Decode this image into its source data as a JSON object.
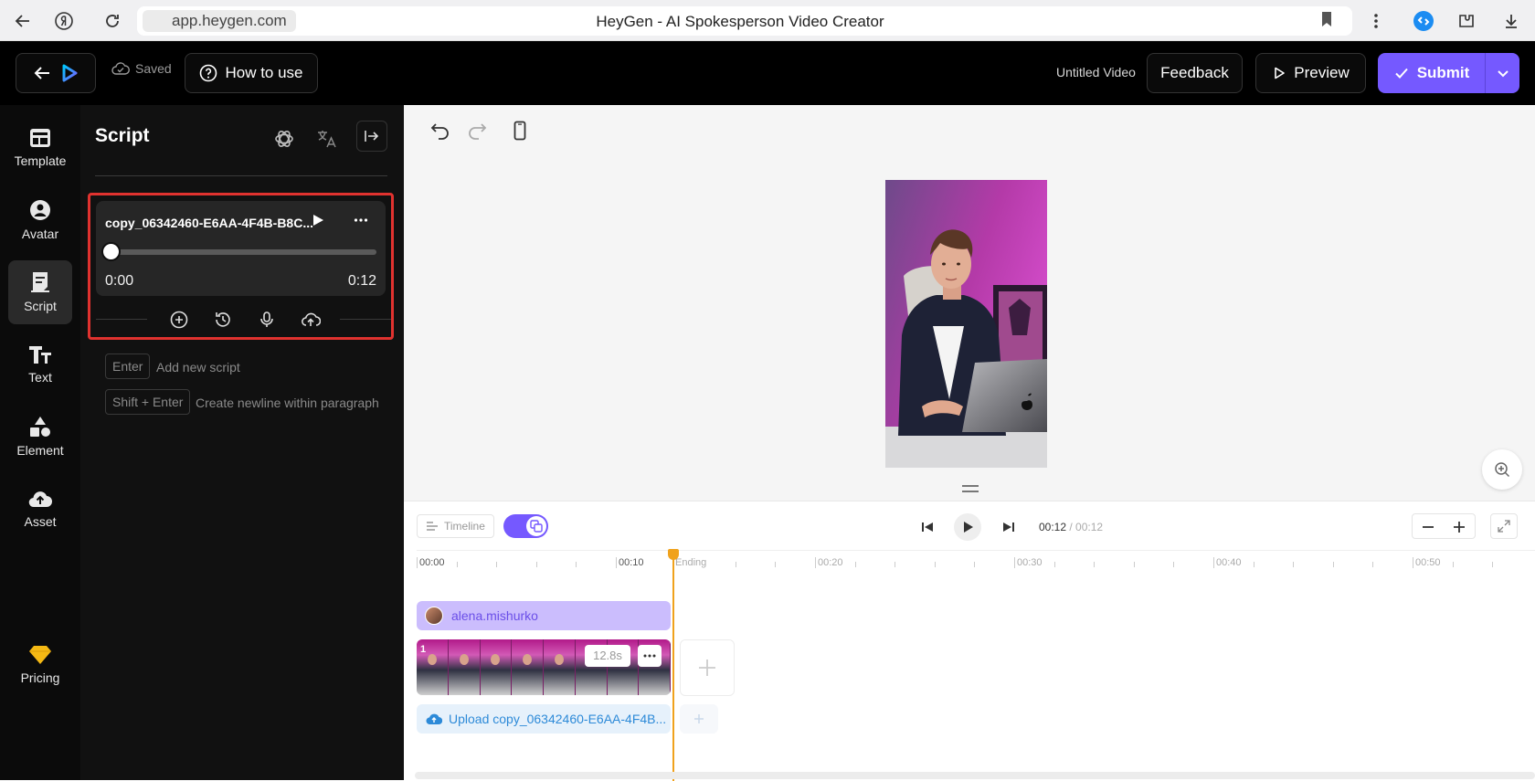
{
  "browser": {
    "url": "app.heygen.com",
    "title": "HeyGen - AI Spokesperson Video Creator"
  },
  "header": {
    "saved_label": "Saved",
    "how_to_use_label": "How to use",
    "video_title": "Untitled Video",
    "feedback_label": "Feedback",
    "preview_label": "Preview",
    "submit_label": "Submit"
  },
  "sidebar": {
    "items": [
      {
        "label": "Template",
        "icon": "template-icon"
      },
      {
        "label": "Avatar",
        "icon": "avatar-icon"
      },
      {
        "label": "Script",
        "icon": "script-icon",
        "active": true
      },
      {
        "label": "Text",
        "icon": "text-icon"
      },
      {
        "label": "Element",
        "icon": "element-icon"
      },
      {
        "label": "Asset",
        "icon": "asset-icon"
      }
    ],
    "pricing_label": "Pricing"
  },
  "script_panel": {
    "title": "Script",
    "audio": {
      "file_name": "copy_06342460-E6AA-4F4B-B8C...",
      "current_time": "0:00",
      "duration": "0:12",
      "progress": 0
    },
    "hints": [
      {
        "key": "Enter",
        "text": "Add new script"
      },
      {
        "key": "Shift + Enter",
        "text": "Create newline within paragraph"
      }
    ]
  },
  "timeline": {
    "label": "Timeline",
    "current_time": "00:12",
    "total_time": "00:12",
    "ruler": {
      "t0": "00:00",
      "t10": "00:10",
      "ending": "Ending",
      "t20": "00:20",
      "t30": "00:30",
      "t40": "00:40",
      "t50": "00:50"
    },
    "avatar_track": "alena.mishurko",
    "scene": {
      "number": "1",
      "duration": "12.8s"
    },
    "upload_track": "Upload copy_06342460-E6AA-4F4B..."
  },
  "colors": {
    "accent": "#7559ff",
    "highlight": "#e0322f",
    "playhead": "#f0a21c"
  }
}
